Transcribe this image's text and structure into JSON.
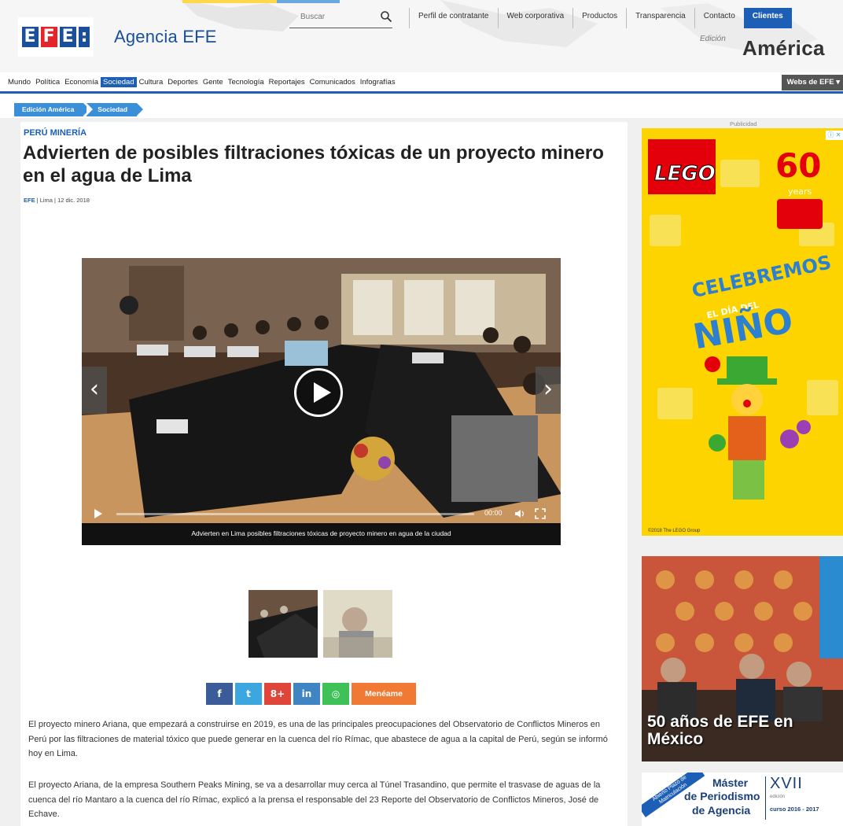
{
  "header": {
    "logo_letters": [
      "E",
      "F",
      "E",
      ":"
    ],
    "logo_text": "Agencia EFE",
    "search_placeholder": "Buscar",
    "top_links": [
      "Perfil de contratante",
      "Web corporativa",
      "Productos",
      "Transparencia",
      "Contacto",
      "Clientes"
    ],
    "edition_label": "Edición",
    "edition_name": "América"
  },
  "nav": {
    "items": [
      "Mundo",
      "Política",
      "Economía",
      "Sociedad",
      "Cultura",
      "Deportes",
      "Gente",
      "Tecnología",
      "Reportajes",
      "Comunicados",
      "Infografías"
    ],
    "active": "Sociedad",
    "webs_button": "Webs de EFE"
  },
  "breadcrumb": [
    "Edición América",
    "Sociedad"
  ],
  "article": {
    "kicker": "PERÚ MINERÍA",
    "title": "Advierten de posibles filtraciones tóxicas de un proyecto minero en el agua de Lima",
    "byline_source": "EFE",
    "byline_rest": " | Lima | 12 dic. 2018",
    "video": {
      "time": "00:00",
      "caption": "Advierten en Lima posibles filtraciones tóxicas de proyecto minero en agua de la ciudad"
    },
    "share": {
      "facebook": "f",
      "twitter": "t",
      "googleplus": "8+",
      "linkedin": "in",
      "whatsapp": "◎",
      "meneame": "Menéame"
    },
    "paragraphs": [
      "El proyecto minero Ariana, que empezará a construirse en 2019, es una de las principales preocupaciones del Observatorio de Conflictos Mineros en Perú por las filtraciones de material tóxico que puede generar en la cuenca del río Rímac, que abastece de agua a la capital de Perú, según se informó hoy en Lima.",
      "El proyecto Ariana, de la empresa Southern Peaks Mining, se va a desarrollar muy cerca al Túnel Trasandino, que permite el trasvase de aguas de la cuenca del río Mantaro a la cuenca del río Rímac, explicó a la prensa el responsable del 23 Reporte del Observatorio de Conflictos Mineros, José de Echave."
    ]
  },
  "sidebar": {
    "pub_label": "Publicidad",
    "lego_ad": {
      "brand": "LEGO",
      "anniv": "60",
      "anniv_sub": "years",
      "line1": "CELEBREMOS",
      "line2": "EL DÍA DEL",
      "line3": "NIÑO",
      "copyright": "©2018 The LEGO Group"
    },
    "efe_ad": {
      "title": "50 años de EFE en México"
    },
    "master_ad": {
      "ribbon": "Abierto Plazo de Matriculación",
      "line1": "Máster",
      "line2": "de Periodismo",
      "line3": "de Agencia",
      "roman": "XVII",
      "edition": "edición",
      "years": "curso 2016 - 2017"
    }
  },
  "colors": {
    "brand_blue": "#1d5fb6",
    "efe_red": "#e4232b",
    "lego_yellow": "#fdd400",
    "meneame_orange": "#f07a33"
  }
}
